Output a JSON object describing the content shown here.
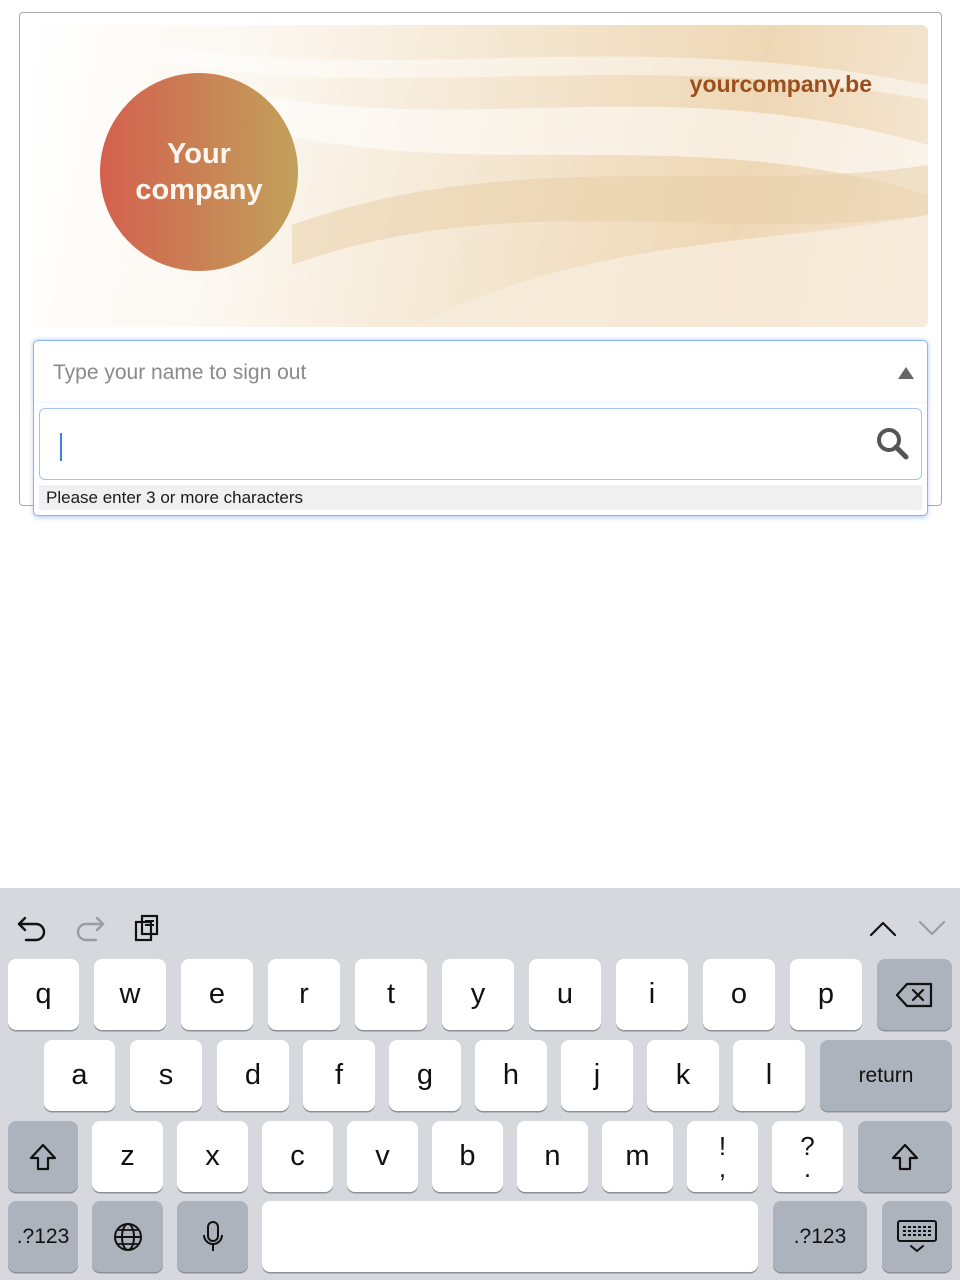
{
  "banner": {
    "logo_line1": "Your",
    "logo_line2": "company",
    "site_url": "yourcompany.be"
  },
  "select": {
    "placeholder": "Type your name to sign out",
    "search_value": "",
    "hint": "Please enter 3 or more characters"
  },
  "keyboard": {
    "row1": [
      "q",
      "w",
      "e",
      "r",
      "t",
      "y",
      "u",
      "i",
      "o",
      "p"
    ],
    "row2": [
      "a",
      "s",
      "d",
      "f",
      "g",
      "h",
      "j",
      "k",
      "l"
    ],
    "row3": [
      "z",
      "x",
      "c",
      "v",
      "b",
      "n",
      "m"
    ],
    "punct1_top": "!",
    "punct1_bottom": ",",
    "punct2_top": "?",
    "punct2_bottom": ".",
    "return_label": "return",
    "numbers_label": ".?123",
    "icons": {
      "undo": "undo-icon",
      "redo": "redo-icon",
      "paste": "paste-icon",
      "prev": "chevron-up-icon",
      "next": "chevron-down-icon",
      "backspace": "backspace-icon",
      "shift": "shift-icon",
      "globe": "globe-icon",
      "mic": "microphone-icon",
      "dismiss": "keyboard-dismiss-icon"
    }
  }
}
